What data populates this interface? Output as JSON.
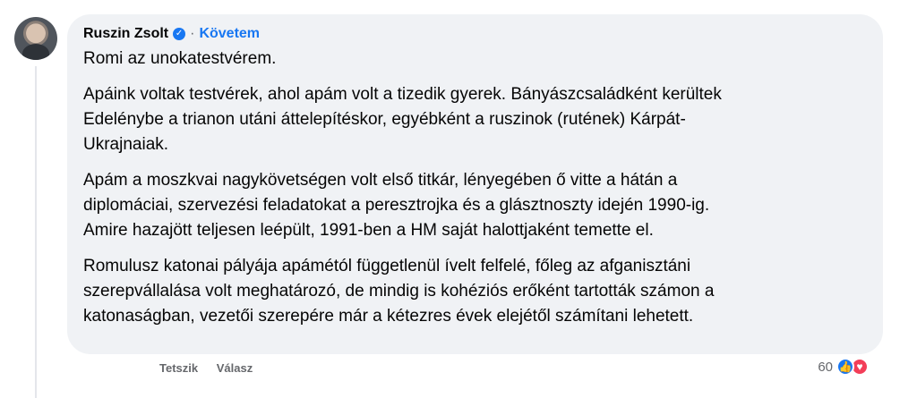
{
  "comment": {
    "author": "Ruszin Zsolt",
    "follow_label": "Követem",
    "paragraph1": "Romi az unokatestvérem.",
    "paragraph2": [
      "Apáink voltak testvérek, ahol apám volt a tizedik gyerek. Bányászcsaládként kerültek",
      "Edelénybe a trianon utáni áttelepítéskor, egyébként a ruszinok (rutének) Kárpát-",
      "Ukrajnaiak."
    ],
    "paragraph3": [
      "Apám a moszkvai nagykövetségen volt első titkár, lényegében ő vitte a hátán a",
      "diplomáciai, szervezési feladatokat a peresztrojka és a glásztnoszty idején 1990-ig.",
      "Amire hazajött teljesen leépült, 1991-ben a HM saját halottjaként temette el."
    ],
    "paragraph4": [
      "Romulusz katonai pályája apámétól függetlenül ívelt felfelé, főleg az afganisztáni",
      "szerepvállalása volt meghatározó, de mindig is kohéziós erőként tartották számon a",
      "katonaságban, vezetői szerepére már a kétezres évek elejétől számítani lehetett."
    ]
  },
  "actions": {
    "like_label": "Tetszik",
    "reply_label": "Válasz"
  },
  "reactions": {
    "count": "60",
    "like_icon": "👍",
    "love_icon": "♥"
  },
  "colors": {
    "accent": "#1877f2",
    "love": "#f33e58"
  }
}
